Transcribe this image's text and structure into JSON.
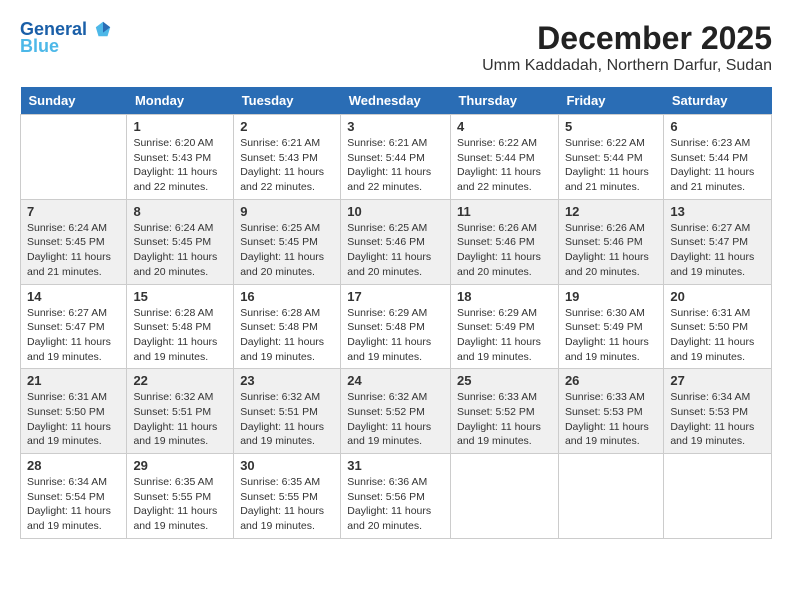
{
  "header": {
    "logo_line1": "General",
    "logo_line2": "Blue",
    "title": "December 2025",
    "subtitle": "Umm Kaddadah, Northern Darfur, Sudan"
  },
  "calendar": {
    "weekdays": [
      "Sunday",
      "Monday",
      "Tuesday",
      "Wednesday",
      "Thursday",
      "Friday",
      "Saturday"
    ],
    "weeks": [
      [
        {
          "day": "",
          "info": ""
        },
        {
          "day": "1",
          "info": "Sunrise: 6:20 AM\nSunset: 5:43 PM\nDaylight: 11 hours\nand 22 minutes."
        },
        {
          "day": "2",
          "info": "Sunrise: 6:21 AM\nSunset: 5:43 PM\nDaylight: 11 hours\nand 22 minutes."
        },
        {
          "day": "3",
          "info": "Sunrise: 6:21 AM\nSunset: 5:44 PM\nDaylight: 11 hours\nand 22 minutes."
        },
        {
          "day": "4",
          "info": "Sunrise: 6:22 AM\nSunset: 5:44 PM\nDaylight: 11 hours\nand 22 minutes."
        },
        {
          "day": "5",
          "info": "Sunrise: 6:22 AM\nSunset: 5:44 PM\nDaylight: 11 hours\nand 21 minutes."
        },
        {
          "day": "6",
          "info": "Sunrise: 6:23 AM\nSunset: 5:44 PM\nDaylight: 11 hours\nand 21 minutes."
        }
      ],
      [
        {
          "day": "7",
          "info": "Sunrise: 6:24 AM\nSunset: 5:45 PM\nDaylight: 11 hours\nand 21 minutes."
        },
        {
          "day": "8",
          "info": "Sunrise: 6:24 AM\nSunset: 5:45 PM\nDaylight: 11 hours\nand 20 minutes."
        },
        {
          "day": "9",
          "info": "Sunrise: 6:25 AM\nSunset: 5:45 PM\nDaylight: 11 hours\nand 20 minutes."
        },
        {
          "day": "10",
          "info": "Sunrise: 6:25 AM\nSunset: 5:46 PM\nDaylight: 11 hours\nand 20 minutes."
        },
        {
          "day": "11",
          "info": "Sunrise: 6:26 AM\nSunset: 5:46 PM\nDaylight: 11 hours\nand 20 minutes."
        },
        {
          "day": "12",
          "info": "Sunrise: 6:26 AM\nSunset: 5:46 PM\nDaylight: 11 hours\nand 20 minutes."
        },
        {
          "day": "13",
          "info": "Sunrise: 6:27 AM\nSunset: 5:47 PM\nDaylight: 11 hours\nand 19 minutes."
        }
      ],
      [
        {
          "day": "14",
          "info": "Sunrise: 6:27 AM\nSunset: 5:47 PM\nDaylight: 11 hours\nand 19 minutes."
        },
        {
          "day": "15",
          "info": "Sunrise: 6:28 AM\nSunset: 5:48 PM\nDaylight: 11 hours\nand 19 minutes."
        },
        {
          "day": "16",
          "info": "Sunrise: 6:28 AM\nSunset: 5:48 PM\nDaylight: 11 hours\nand 19 minutes."
        },
        {
          "day": "17",
          "info": "Sunrise: 6:29 AM\nSunset: 5:48 PM\nDaylight: 11 hours\nand 19 minutes."
        },
        {
          "day": "18",
          "info": "Sunrise: 6:29 AM\nSunset: 5:49 PM\nDaylight: 11 hours\nand 19 minutes."
        },
        {
          "day": "19",
          "info": "Sunrise: 6:30 AM\nSunset: 5:49 PM\nDaylight: 11 hours\nand 19 minutes."
        },
        {
          "day": "20",
          "info": "Sunrise: 6:31 AM\nSunset: 5:50 PM\nDaylight: 11 hours\nand 19 minutes."
        }
      ],
      [
        {
          "day": "21",
          "info": "Sunrise: 6:31 AM\nSunset: 5:50 PM\nDaylight: 11 hours\nand 19 minutes."
        },
        {
          "day": "22",
          "info": "Sunrise: 6:32 AM\nSunset: 5:51 PM\nDaylight: 11 hours\nand 19 minutes."
        },
        {
          "day": "23",
          "info": "Sunrise: 6:32 AM\nSunset: 5:51 PM\nDaylight: 11 hours\nand 19 minutes."
        },
        {
          "day": "24",
          "info": "Sunrise: 6:32 AM\nSunset: 5:52 PM\nDaylight: 11 hours\nand 19 minutes."
        },
        {
          "day": "25",
          "info": "Sunrise: 6:33 AM\nSunset: 5:52 PM\nDaylight: 11 hours\nand 19 minutes."
        },
        {
          "day": "26",
          "info": "Sunrise: 6:33 AM\nSunset: 5:53 PM\nDaylight: 11 hours\nand 19 minutes."
        },
        {
          "day": "27",
          "info": "Sunrise: 6:34 AM\nSunset: 5:53 PM\nDaylight: 11 hours\nand 19 minutes."
        }
      ],
      [
        {
          "day": "28",
          "info": "Sunrise: 6:34 AM\nSunset: 5:54 PM\nDaylight: 11 hours\nand 19 minutes."
        },
        {
          "day": "29",
          "info": "Sunrise: 6:35 AM\nSunset: 5:55 PM\nDaylight: 11 hours\nand 19 minutes."
        },
        {
          "day": "30",
          "info": "Sunrise: 6:35 AM\nSunset: 5:55 PM\nDaylight: 11 hours\nand 19 minutes."
        },
        {
          "day": "31",
          "info": "Sunrise: 6:36 AM\nSunset: 5:56 PM\nDaylight: 11 hours\nand 20 minutes."
        },
        {
          "day": "",
          "info": ""
        },
        {
          "day": "",
          "info": ""
        },
        {
          "day": "",
          "info": ""
        }
      ]
    ]
  }
}
